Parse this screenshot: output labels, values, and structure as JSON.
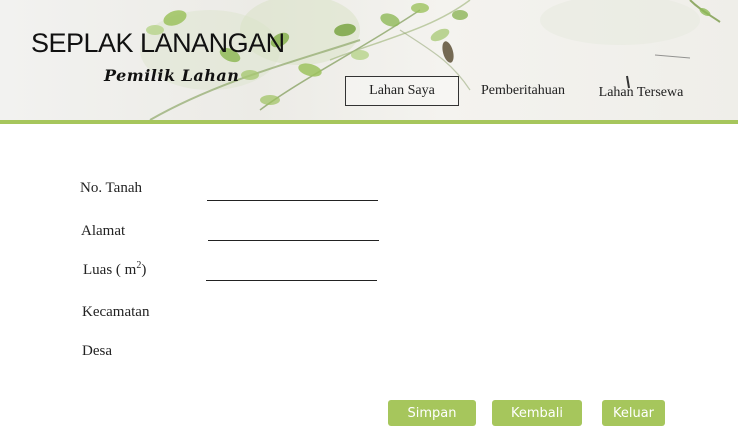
{
  "header": {
    "title": "SEPLAK LANANGAN",
    "subtitle": "Pemilik Lahan",
    "accent_color": "#a6c65c"
  },
  "nav": {
    "tabs": [
      {
        "label": "Lahan Saya",
        "active": true
      },
      {
        "label": "Pemberitahuan",
        "active": false
      },
      {
        "label": "Lahan Tersewa",
        "active": false
      }
    ]
  },
  "form": {
    "no_tanah_label": "No. Tanah",
    "alamat_label": "Alamat",
    "luas_label_prefix": "Luas ( m",
    "luas_label_sup": "2",
    "luas_label_suffix": ")",
    "kecamatan_label": "Kecamatan",
    "desa_label": "Desa",
    "no_tanah_value": "",
    "alamat_value": "",
    "luas_value": ""
  },
  "buttons": {
    "simpan": "Simpan",
    "kembali": "Kembali",
    "keluar": "Keluar"
  }
}
